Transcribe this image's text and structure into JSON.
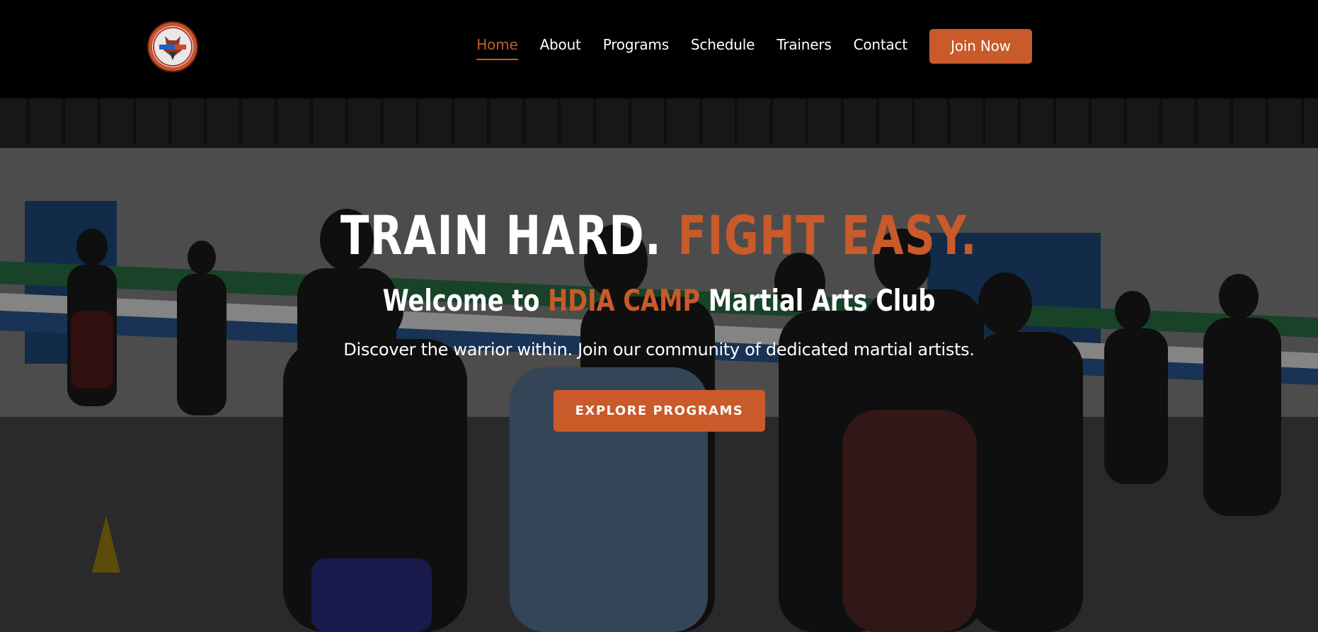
{
  "brand": {
    "logo_icon": "hdia-camp-logo",
    "accent_color": "#c95a29"
  },
  "nav": {
    "items": [
      {
        "label": "Home",
        "active": true
      },
      {
        "label": "About"
      },
      {
        "label": "Programs"
      },
      {
        "label": "Schedule"
      },
      {
        "label": "Trainers"
      },
      {
        "label": "Contact"
      }
    ],
    "join_label": "Join Now"
  },
  "hero": {
    "background": "martial-arts-gym-photo",
    "title_part1": "TRAIN HARD.",
    "title_part2": "FIGHT EASY.",
    "subtitle_prefix": "Welcome to",
    "subtitle_brand": "HDIA CAMP",
    "subtitle_suffix": "Martial Arts Club",
    "tagline": "Discover the warrior within. Join our community of dedicated martial artists.",
    "cta_label": "EXPLORE PROGRAMS"
  }
}
